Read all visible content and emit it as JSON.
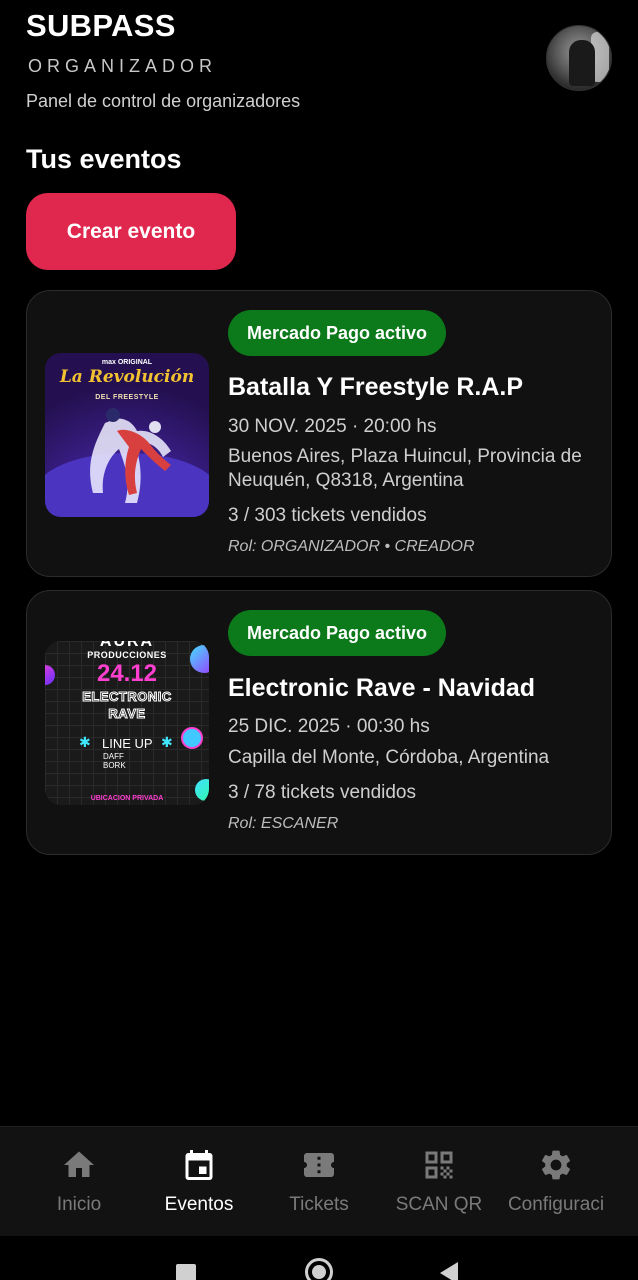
{
  "header": {
    "brand": "SUBPASS",
    "brand_sub": "ORGANIZADOR",
    "tagline": "Panel de control de organizadores"
  },
  "main": {
    "section_title": "Tus eventos",
    "create_button": "Crear evento"
  },
  "events": [
    {
      "badge": "Mercado Pago activo",
      "title": "Batalla Y Freestyle R.A.P",
      "date": "30 NOV. 2025 · 20:00 hs",
      "location": "Buenos Aires, Plaza Huincul, Provincia de Neuquén, Q8318, Argentina",
      "tickets": "3 / 303 tickets vendidos",
      "role": "Rol: ORGANIZADOR • CREADOR",
      "poster": {
        "top_label": "max ORIGINAL",
        "title": "La Revolución",
        "subtitle": "DEL FREESTYLE"
      }
    },
    {
      "badge": "Mercado Pago activo",
      "title": "Electronic Rave - Navidad",
      "date": "25 DIC. 2025 · 00:30 hs",
      "location": "Capilla del Monte, Córdoba, Argentina",
      "tickets": "3 / 78 tickets vendidos",
      "role": "Rol: ESCANER",
      "poster": {
        "top_label": "AURA",
        "producer": "PRODUCCIONES",
        "date": "24.12",
        "title_line1": "ELECTRONIC",
        "title_line2": "RAVE",
        "lineup_head": "LINE UP",
        "lineup_1": "DAFF",
        "lineup_2": "BORK",
        "footer": "UBICACION PRIVADA"
      }
    }
  ],
  "bottom_nav": {
    "items": [
      {
        "label": "Inicio",
        "icon": "home-icon",
        "active": false
      },
      {
        "label": "Eventos",
        "icon": "calendar-icon",
        "active": true
      },
      {
        "label": "Tickets",
        "icon": "ticket-icon",
        "active": false
      },
      {
        "label": "SCAN QR",
        "icon": "qr-icon",
        "active": false
      },
      {
        "label": "Configuraci",
        "icon": "gear-icon",
        "active": false
      }
    ]
  },
  "colors": {
    "accent": "#e0284f",
    "badge_green": "#0c7a1b",
    "background": "#000000",
    "card": "#111111"
  }
}
